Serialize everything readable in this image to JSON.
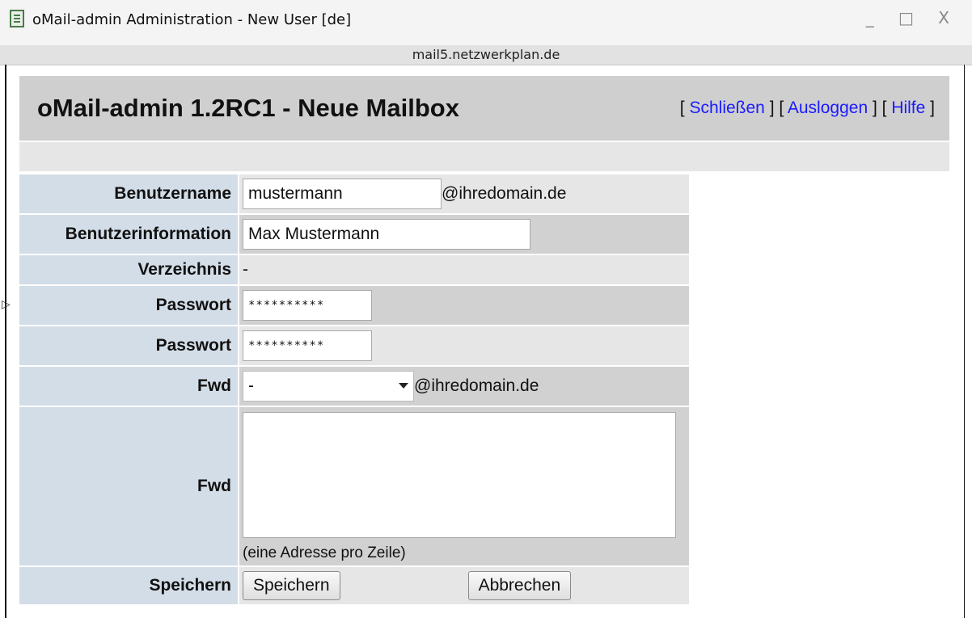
{
  "window": {
    "title": "oMail-admin Administration - New User [de]",
    "controls": "_ □ X",
    "host": "mail5.netzwerkplan.de"
  },
  "header": {
    "title": "oMail-admin 1.2RC1 - Neue Mailbox",
    "links": {
      "open": "[ ",
      "close_label": "Schließen",
      "sep1": " ] [ ",
      "logout_label": "Ausloggen",
      "sep2": " ] [ ",
      "help_label": "Hilfe",
      "end": " ]"
    }
  },
  "form": {
    "username": {
      "label": "Benutzername",
      "value": "mustermann",
      "domain": "@ihredomain.de"
    },
    "userinfo": {
      "label": "Benutzerinformation",
      "value": "Max Mustermann"
    },
    "directory": {
      "label": "Verzeichnis",
      "value": "-"
    },
    "password": {
      "label": "Passwort",
      "value": "**********"
    },
    "password_confirm": {
      "label": "Passwort",
      "value": "**********"
    },
    "fwd_select": {
      "label": "Fwd",
      "selected": "-",
      "domain": "@ihredomain.de"
    },
    "fwd_list": {
      "label": "Fwd",
      "value": "",
      "hint": "(eine Adresse pro Zeile)"
    },
    "save": {
      "label": "Speichern",
      "save_button": "Speichern",
      "cancel_button": "Abbrechen"
    }
  }
}
